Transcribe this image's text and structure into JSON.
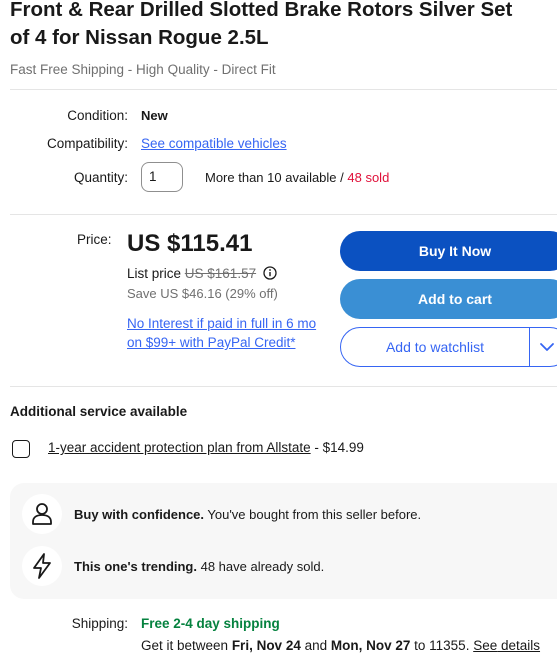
{
  "product": {
    "title_line1": "Front & Rear Drilled Slotted Brake Rotors Silver Set",
    "title_line2": "of 4 for Nissan Rogue 2.5L",
    "subtitle": "Fast Free Shipping - High Quality - Direct Fit"
  },
  "details": {
    "condition_label": "Condition:",
    "condition_value": "New",
    "compat_label": "Compatibility:",
    "compat_link": "See compatible vehicles",
    "qty_label": "Quantity:",
    "qty_value": "1",
    "availability": "More than 10 available / ",
    "sold": "48 sold"
  },
  "pricing": {
    "price_label": "Price:",
    "price": "US $115.41",
    "list_price_label": "List price ",
    "list_price": "US $161.57",
    "save": "Save US $46.16 (29% off)",
    "financing": "No Interest if paid in full in 6 mo on $99+ with PayPal Credit*"
  },
  "buttons": {
    "buy": "Buy It Now",
    "cart": "Add to cart",
    "watch": "Add to watchlist"
  },
  "service": {
    "heading": "Additional service available",
    "plan_link": "1-year accident protection plan from Allstate",
    "plan_price": " - $14.99"
  },
  "confidence": {
    "row1_bold": "Buy with confidence.",
    "row1_text": " You've bought from this seller before.",
    "row2_bold": "This one's trending.",
    "row2_text": " 48 have already sold."
  },
  "shipping": {
    "label": "Shipping:",
    "free": "Free 2-4 day shipping",
    "get": "Get it between ",
    "date1": "Fri, Nov 24",
    "and": " and ",
    "date2": "Mon, Nov 27",
    "to": " to 11355. ",
    "see": "See",
    "details": "details"
  },
  "colors": {
    "accent": "#3665f3",
    "buy": "#0b51c1",
    "cart": "#3a8fd4",
    "sold": "#e0103a",
    "free": "#05823f"
  }
}
